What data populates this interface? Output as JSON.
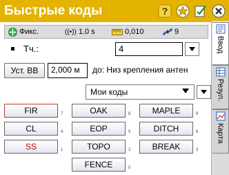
{
  "window": {
    "title": "Быстрые коды"
  },
  "title_icons": [
    "help-icon",
    "favorites-icon",
    "settings-icon",
    "close-icon"
  ],
  "status": {
    "mode": "Фикс.",
    "epoch": "1.0 s",
    "precision": "0,010",
    "satellites": "9"
  },
  "point": {
    "label": "Тч.:",
    "value": "4"
  },
  "antenna": {
    "button_label": "Уст. ВВ",
    "height": "2,000 м",
    "to_label": "до: Низ крепления антен"
  },
  "codes_list": {
    "selected": "Мои коды"
  },
  "codes": [
    {
      "label": "FIR",
      "hotkey": "7"
    },
    {
      "label": "OAK",
      "hotkey": "8"
    },
    {
      "label": "MAPLE",
      "hotkey": "9"
    },
    {
      "label": "CL",
      "hotkey": "4"
    },
    {
      "label": "EOP",
      "hotkey": "5"
    },
    {
      "label": "DITCH",
      "hotkey": "6"
    },
    {
      "label": "SS",
      "hotkey": "1"
    },
    {
      "label": "TOPO",
      "hotkey": "2"
    },
    {
      "label": "BREAK",
      "hotkey": "3"
    },
    {
      "label": "FENCE",
      "hotkey": "0"
    }
  ],
  "side_tabs": [
    {
      "label": "Ввод",
      "active": true
    },
    {
      "label": "Резул.",
      "active": false
    },
    {
      "label": "Карта",
      "active": false
    }
  ],
  "colors": {
    "title_bar": "#e3b300",
    "ss_text": "#d00000",
    "fir_border": "#c0392b"
  }
}
